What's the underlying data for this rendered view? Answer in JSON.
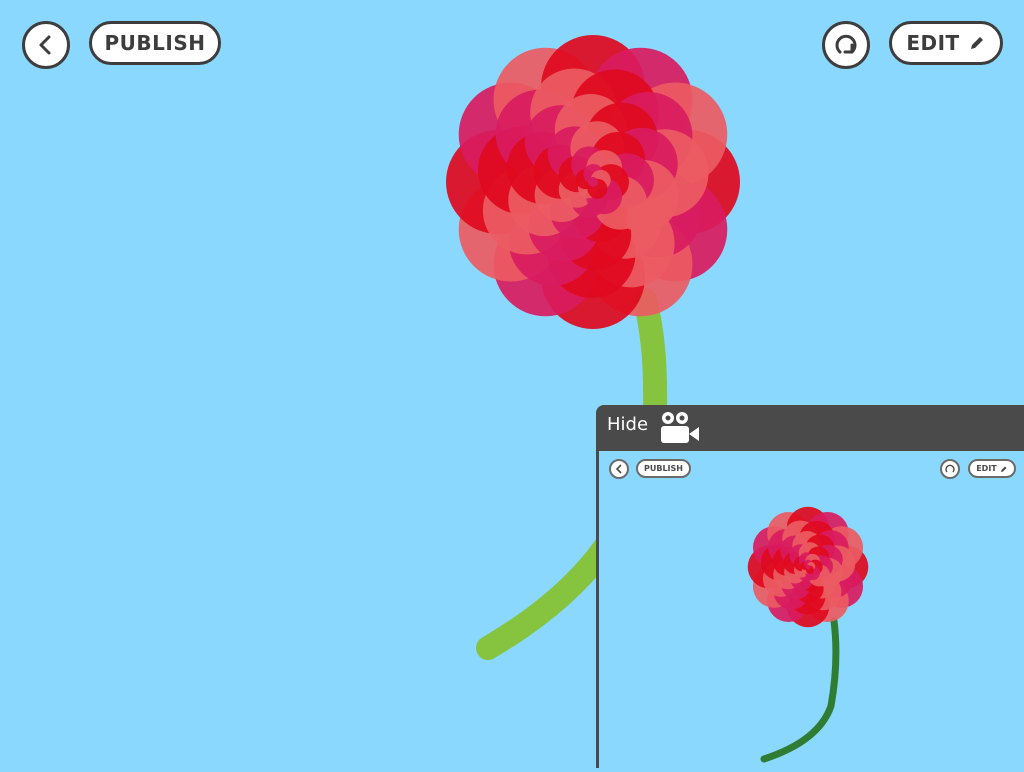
{
  "toolbar": {
    "back_icon": "chevron-left-icon",
    "publish_label": "PUBLISH",
    "restart_icon": "restart-icon",
    "edit_label": "EDIT",
    "edit_icon": "pencil-icon"
  },
  "recording_panel": {
    "hide_label": "Hide",
    "camera_icon": "video-camera-icon",
    "preview": {
      "publish_label": "PUBLISH",
      "edit_label": "EDIT"
    }
  },
  "colors": {
    "background": "#8ad8fd",
    "stem": "#86c43f",
    "preview_stem": "#2f7d32",
    "petal_red": "#e0091e",
    "petal_magenta": "#d91b60",
    "petal_coral": "#ec5b62",
    "button_border": "#3d3d3d",
    "panel_bar": "#4a4a4a"
  }
}
